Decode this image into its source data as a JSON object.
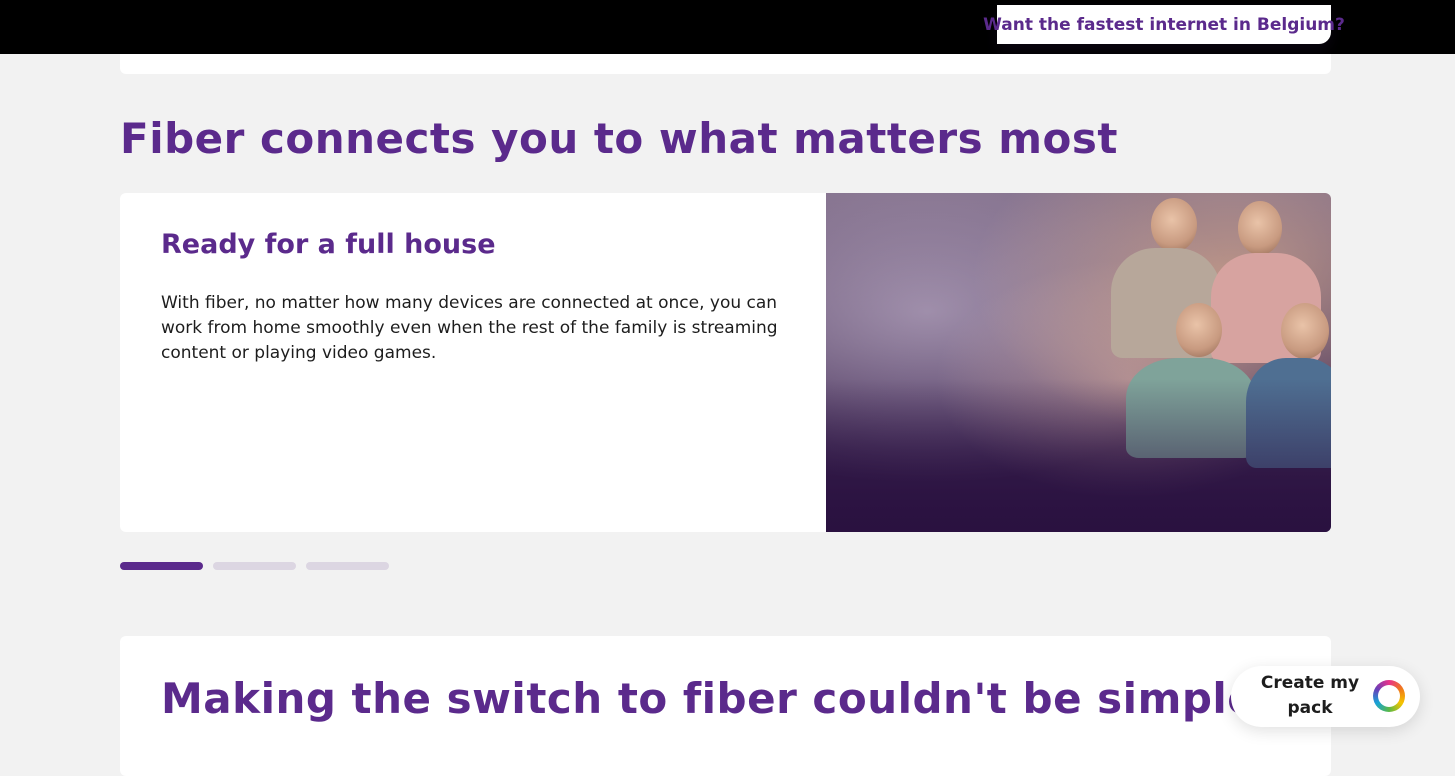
{
  "header": {
    "cta_label": "Want the fastest internet in Belgium?"
  },
  "section": {
    "title": "Fiber connects you to what matters most"
  },
  "carousel": {
    "active_index": 0,
    "slide_count": 3,
    "slide": {
      "title": "Ready for a full house",
      "text": "With fiber, no matter how many devices are connected at once, you can work from home smoothly even when the rest of the family is streaming content or playing video games."
    }
  },
  "next_section": {
    "title": "Making the switch to fiber couldn't be simpler"
  },
  "fab": {
    "label": "Create my pack",
    "icon": "brand-ring-icon"
  },
  "colors": {
    "brand_purple": "#5b2a8c",
    "topbar": "#000000",
    "background": "#f2f2f2"
  }
}
